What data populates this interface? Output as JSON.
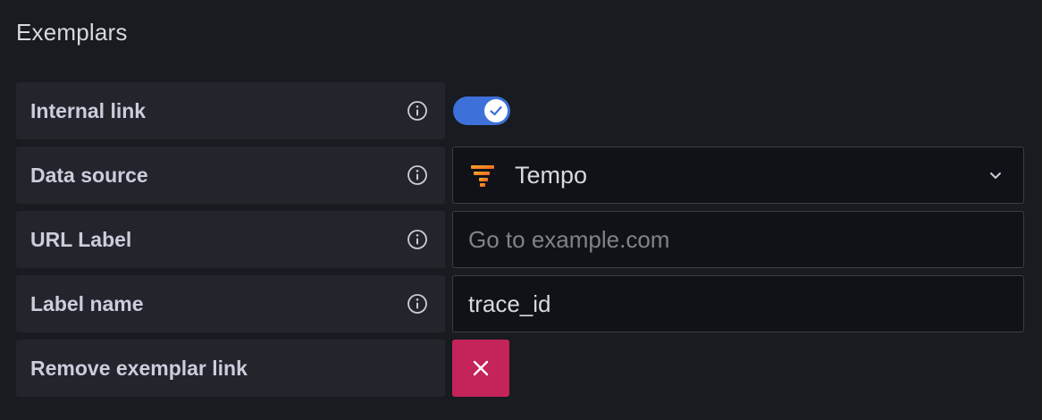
{
  "section": {
    "title": "Exemplars"
  },
  "rows": {
    "internal_link": {
      "label": "Internal link",
      "enabled": true
    },
    "data_source": {
      "label": "Data source",
      "value": "Tempo",
      "icon": "tempo-logo-icon"
    },
    "url_label": {
      "label": "URL Label",
      "value": "",
      "placeholder": "Go to example.com"
    },
    "label_name": {
      "label": "Label name",
      "value": "trace_id"
    },
    "remove": {
      "label": "Remove exemplar link"
    }
  },
  "colors": {
    "background": "#181b1f",
    "label_background": "#22252b",
    "toggle_on": "#3d71d9",
    "remove_button": "#c4245a"
  }
}
